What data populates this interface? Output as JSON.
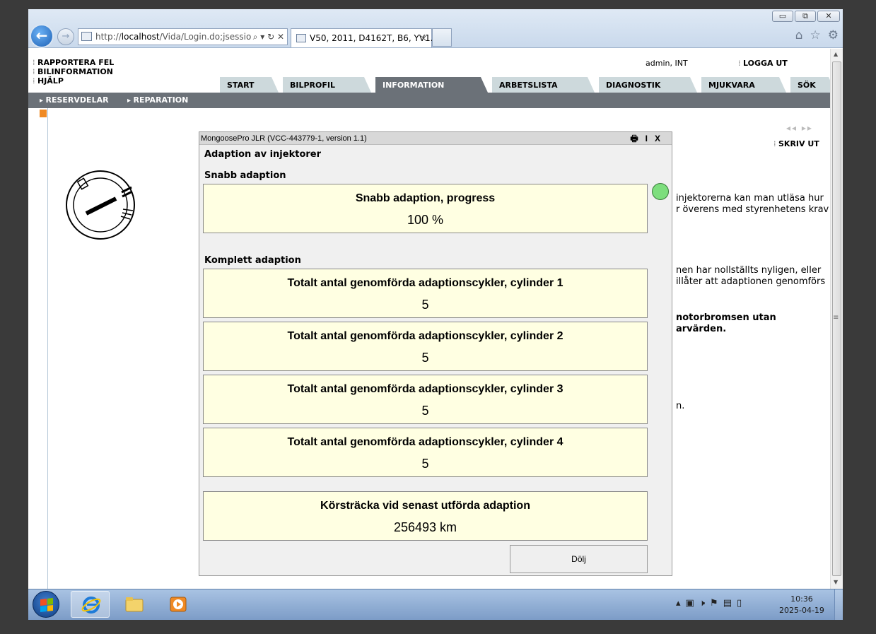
{
  "browser": {
    "url_prefix": "http://",
    "url_host": "localhost",
    "url_rest": "/Vida/Login.do;jsessio",
    "tab_title": "V50, 2011, D4162T, B6, YV1...",
    "tab_close": "×",
    "win_minimize": "▭",
    "win_restore": "⧉",
    "win_close": "✕"
  },
  "header": {
    "links": [
      "RAPPORTERA FEL",
      "BILINFORMATION",
      "HJÄLP"
    ],
    "user": "admin, INT",
    "logout": "LOGGA UT"
  },
  "nav": {
    "tabs": [
      "START",
      "BILPROFIL",
      "INFORMATION",
      "ARBETSLISTA",
      "DIAGNOSTIK",
      "MJUKVARA",
      "SÖK"
    ],
    "active": "INFORMATION",
    "sub": [
      "RESERVDELAR",
      "REPARATION"
    ]
  },
  "content": {
    "print": "SKRIV UT",
    "pager": "◂◂  ▸▸",
    "text_lines": [
      "injektorerna kan man utläsa hur",
      "r överens med styrenhetens krav",
      "nen har nollställts nyligen, eller",
      "illåter att adaptionen genomförs",
      "notorbromsen utan",
      "arvärden.",
      "n."
    ]
  },
  "dialog": {
    "title": "MongoosePro JLR   (VCC-443779-1, version 1.1)",
    "tool_i": "I",
    "tool_x": "X",
    "heading": "Adaption av injektorer",
    "section_quick": "Snabb adaption",
    "section_full": "Komplett adaption",
    "quick_label": "Snabb adaption, progress",
    "quick_value": "100 %",
    "cylinders": [
      {
        "label": "Totalt antal genomförda adaptionscykler, cylinder 1",
        "value": "5"
      },
      {
        "label": "Totalt antal genomförda adaptionscykler, cylinder 2",
        "value": "5"
      },
      {
        "label": "Totalt antal genomförda adaptionscykler, cylinder 3",
        "value": "5"
      },
      {
        "label": "Totalt antal genomförda adaptionscykler, cylinder 4",
        "value": "5"
      }
    ],
    "distance_label": "Körsträcka vid senast utförda adaption",
    "distance_value": "256493 km",
    "hide_button": "Dölj",
    "status_color": "#7dde7d"
  },
  "taskbar": {
    "time": "10:36",
    "date": "2025-04-19"
  }
}
